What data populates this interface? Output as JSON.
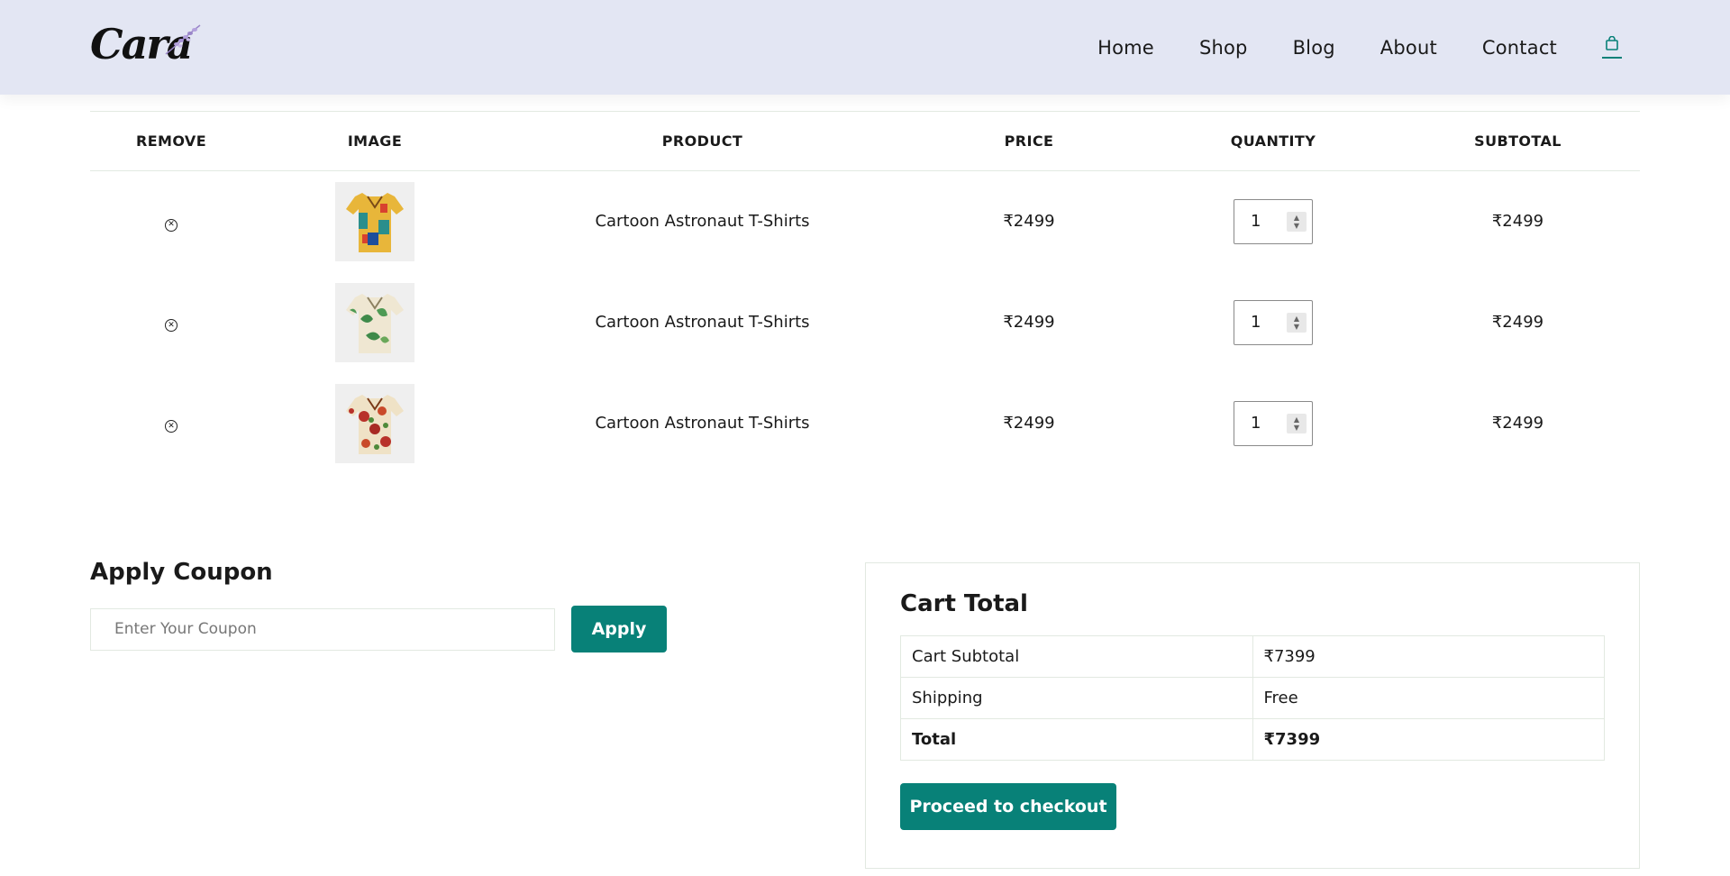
{
  "header": {
    "logo_text": "Cara",
    "nav": [
      "Home",
      "Shop",
      "Blog",
      "About",
      "Contact"
    ],
    "cart_icon": "shopping-bag-icon",
    "accent_color": "#088178",
    "background": "#e3e6f3"
  },
  "cart": {
    "headers": [
      "REMOVE",
      "IMAGE",
      "PRODUCT",
      "PRICE",
      "QUANTITY",
      "SUBTOTAL"
    ],
    "rows": [
      {
        "product": "Cartoon Astronaut T-Shirts",
        "price": "₹2499",
        "quantity": "1",
        "subtotal": "₹2499",
        "image": "yellow-teal-print-shirt"
      },
      {
        "product": "Cartoon Astronaut T-Shirts",
        "price": "₹2499",
        "quantity": "1",
        "subtotal": "₹2499",
        "image": "cream-green-leaf-shirt"
      },
      {
        "product": "Cartoon Astronaut T-Shirts",
        "price": "₹2499",
        "quantity": "1",
        "subtotal": "₹2499",
        "image": "cream-red-floral-shirt"
      }
    ]
  },
  "coupon": {
    "title": "Apply Coupon",
    "placeholder": "Enter Your Coupon",
    "button": "Apply"
  },
  "totals": {
    "title": "Cart Total",
    "rows": [
      {
        "label": "Cart Subtotal",
        "value": "₹7399"
      },
      {
        "label": "Shipping",
        "value": "Free"
      },
      {
        "label": "Total",
        "value": "₹7399"
      }
    ],
    "checkout_button": "Proceed to checkout"
  }
}
